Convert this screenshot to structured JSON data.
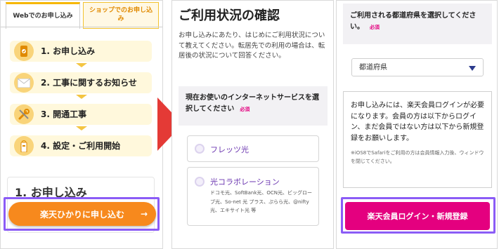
{
  "screen1": {
    "tabs": {
      "web": "Webでのお申し込み",
      "shop": "ショップでのお申し込み"
    },
    "steps": [
      {
        "label": "1. お申し込み",
        "icon": "smartphone-icon"
      },
      {
        "label": "2. 工事に関するお知らせ",
        "icon": "envelope-icon"
      },
      {
        "label": "3. 開通工事",
        "icon": "tools-icon"
      },
      {
        "label": "4. 設定・ご利用開始",
        "icon": "router-icon"
      }
    ],
    "heading_partial": "1. お申し込み",
    "apply_button": "楽天ひかりに申し込む",
    "apply_arrow": "→"
  },
  "screen2": {
    "title": "ご利用状況の確認",
    "description": "お申し込みにあたり、はじめにご利用状況について教えてください。転居先での利用の場合は、転居後の状況について回答ください。",
    "question": "現在お使いのインターネットサービスを選択してください",
    "required": "必須",
    "options": [
      {
        "label": "フレッツ光",
        "sub": ""
      },
      {
        "label": "光コラボレーション",
        "sub": "ドコモ光、SoftBank光、OCN光、ビッグローブ光、So-net 光 プラス、ぷらら光、@nifty光、エキサイト光 等"
      }
    ]
  },
  "screen3": {
    "question": "ご利用される都道府県を選択してください。",
    "required": "必須",
    "select_value": "都道府県",
    "info_text": "お申し込みには、楽天会員ログインが必要になります。会員の方は以下からログイン、まだ会員ではない方は以下から新規登録をお願いします。",
    "note": "※iOS8でSafariをご利用の方は会員情報入力後、ウィンドウを閉じてください。",
    "login_button": "楽天会員ログイン・新規登録"
  },
  "colors": {
    "orange": "#f7891d",
    "pink": "#e4007f",
    "highlight": "#8b5cf6",
    "arrow": "#e43a36"
  }
}
